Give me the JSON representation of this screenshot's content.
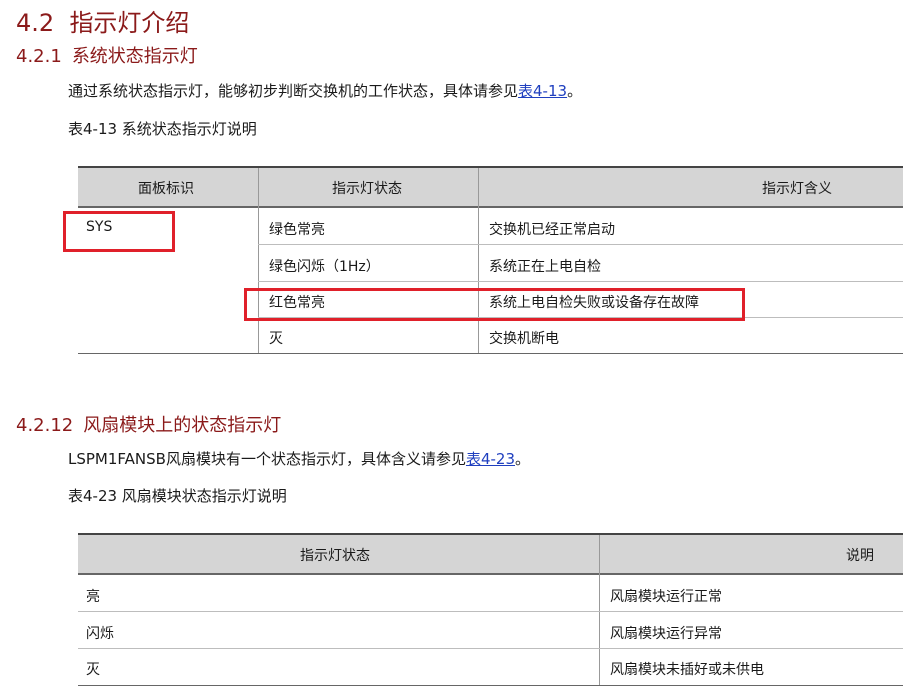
{
  "section": {
    "number": "4.2",
    "title": "指示灯介绍"
  },
  "sub1": {
    "number": "4.2.1",
    "title": "系统状态指示灯",
    "para_text": "通过系统状态指示灯，能够初步判断交换机的工作状态，具体请参见",
    "para_link": "表4-13",
    "para_end": "。",
    "caption": "表4-13 系统状态指示灯说明",
    "table": {
      "headers": [
        "面板标识",
        "指示灯状态",
        "指示灯含义"
      ],
      "panel_id": "SYS",
      "rows": [
        {
          "state": "绿色常亮",
          "meaning": "交换机已经正常启动"
        },
        {
          "state": "绿色闪烁（1Hz）",
          "meaning": "系统正在上电自检"
        },
        {
          "state": "红色常亮",
          "meaning": "系统上电自检失败或设备存在故障"
        },
        {
          "state": "灭",
          "meaning": "交换机断电"
        }
      ]
    }
  },
  "sub2": {
    "number": "4.2.12",
    "title": "风扇模块上的状态指示灯",
    "para_text": "LSPM1FANSB风扇模块有一个状态指示灯，具体含义请参见",
    "para_link": "表4-23",
    "para_end": "。",
    "caption": "表4-23 风扇模块状态指示灯说明",
    "table": {
      "headers": [
        "指示灯状态",
        "说明"
      ],
      "rows": [
        {
          "state": "亮",
          "meaning": "风扇模块运行正常"
        },
        {
          "state": "闪烁",
          "meaning": "风扇模块运行异常"
        },
        {
          "state": "灭",
          "meaning": "风扇模块未插好或未供电"
        }
      ]
    }
  },
  "colors": {
    "heading": "#8b1a1a",
    "link": "#1f3fbf",
    "highlight": "#e0202a",
    "table_header_bg": "#d5d5d5"
  }
}
